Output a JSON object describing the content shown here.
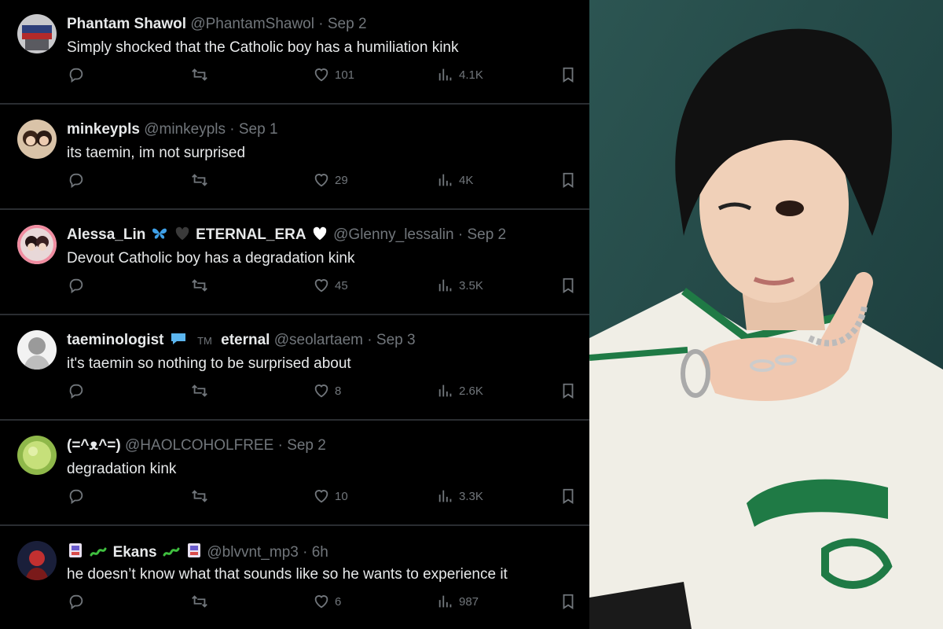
{
  "feed": {
    "tweets": [
      {
        "name": "Phantam Shawol",
        "handle": "@PhantamShawol",
        "date": "Sep 2",
        "text": "Simply shocked that the Catholic boy has a humiliation kink",
        "likes": "101",
        "views": "4.1K"
      },
      {
        "name": "minkeypls",
        "handle": "@minkeypls",
        "date": "Sep 1",
        "text": "its taemin, im not surprised",
        "likes": "29",
        "views": "4K"
      },
      {
        "name": "Alessa_Lin",
        "name2": "ETERNAL_ERA",
        "handle": "@Glenny_lessalin",
        "date": "Sep 2",
        "text": "Devout Catholic boy has a degradation kink",
        "likes": "45",
        "views": "3.5K"
      },
      {
        "name": "taeminologist",
        "tm": "TM",
        "name2": "eternal",
        "handle": "@seolartaem",
        "date": "Sep 3",
        "text": "it's taemin so nothing to be surprised about",
        "likes": "8",
        "views": "2.6K"
      },
      {
        "name": "(=^ᴥ^=)",
        "handle": "@HAOLCOHOLFREE",
        "date": "Sep 2",
        "text": "degradation kink",
        "likes": "10",
        "views": "3.3K"
      },
      {
        "name": "Ekans",
        "handle": "@blvvnt_mp3",
        "date": "6h",
        "text": "he doesn’t know what that sounds like so he wants to experience it",
        "likes": "6",
        "views": "987"
      }
    ]
  },
  "icons": {
    "reply": "reply-icon",
    "retweet": "retweet-icon",
    "like": "heart-icon",
    "views": "views-icon",
    "bookmark": "bookmark-icon"
  },
  "colors": {
    "background": "#000000",
    "text": "#e7e9ea",
    "muted": "#71767b",
    "divider": "#2a2d31"
  }
}
